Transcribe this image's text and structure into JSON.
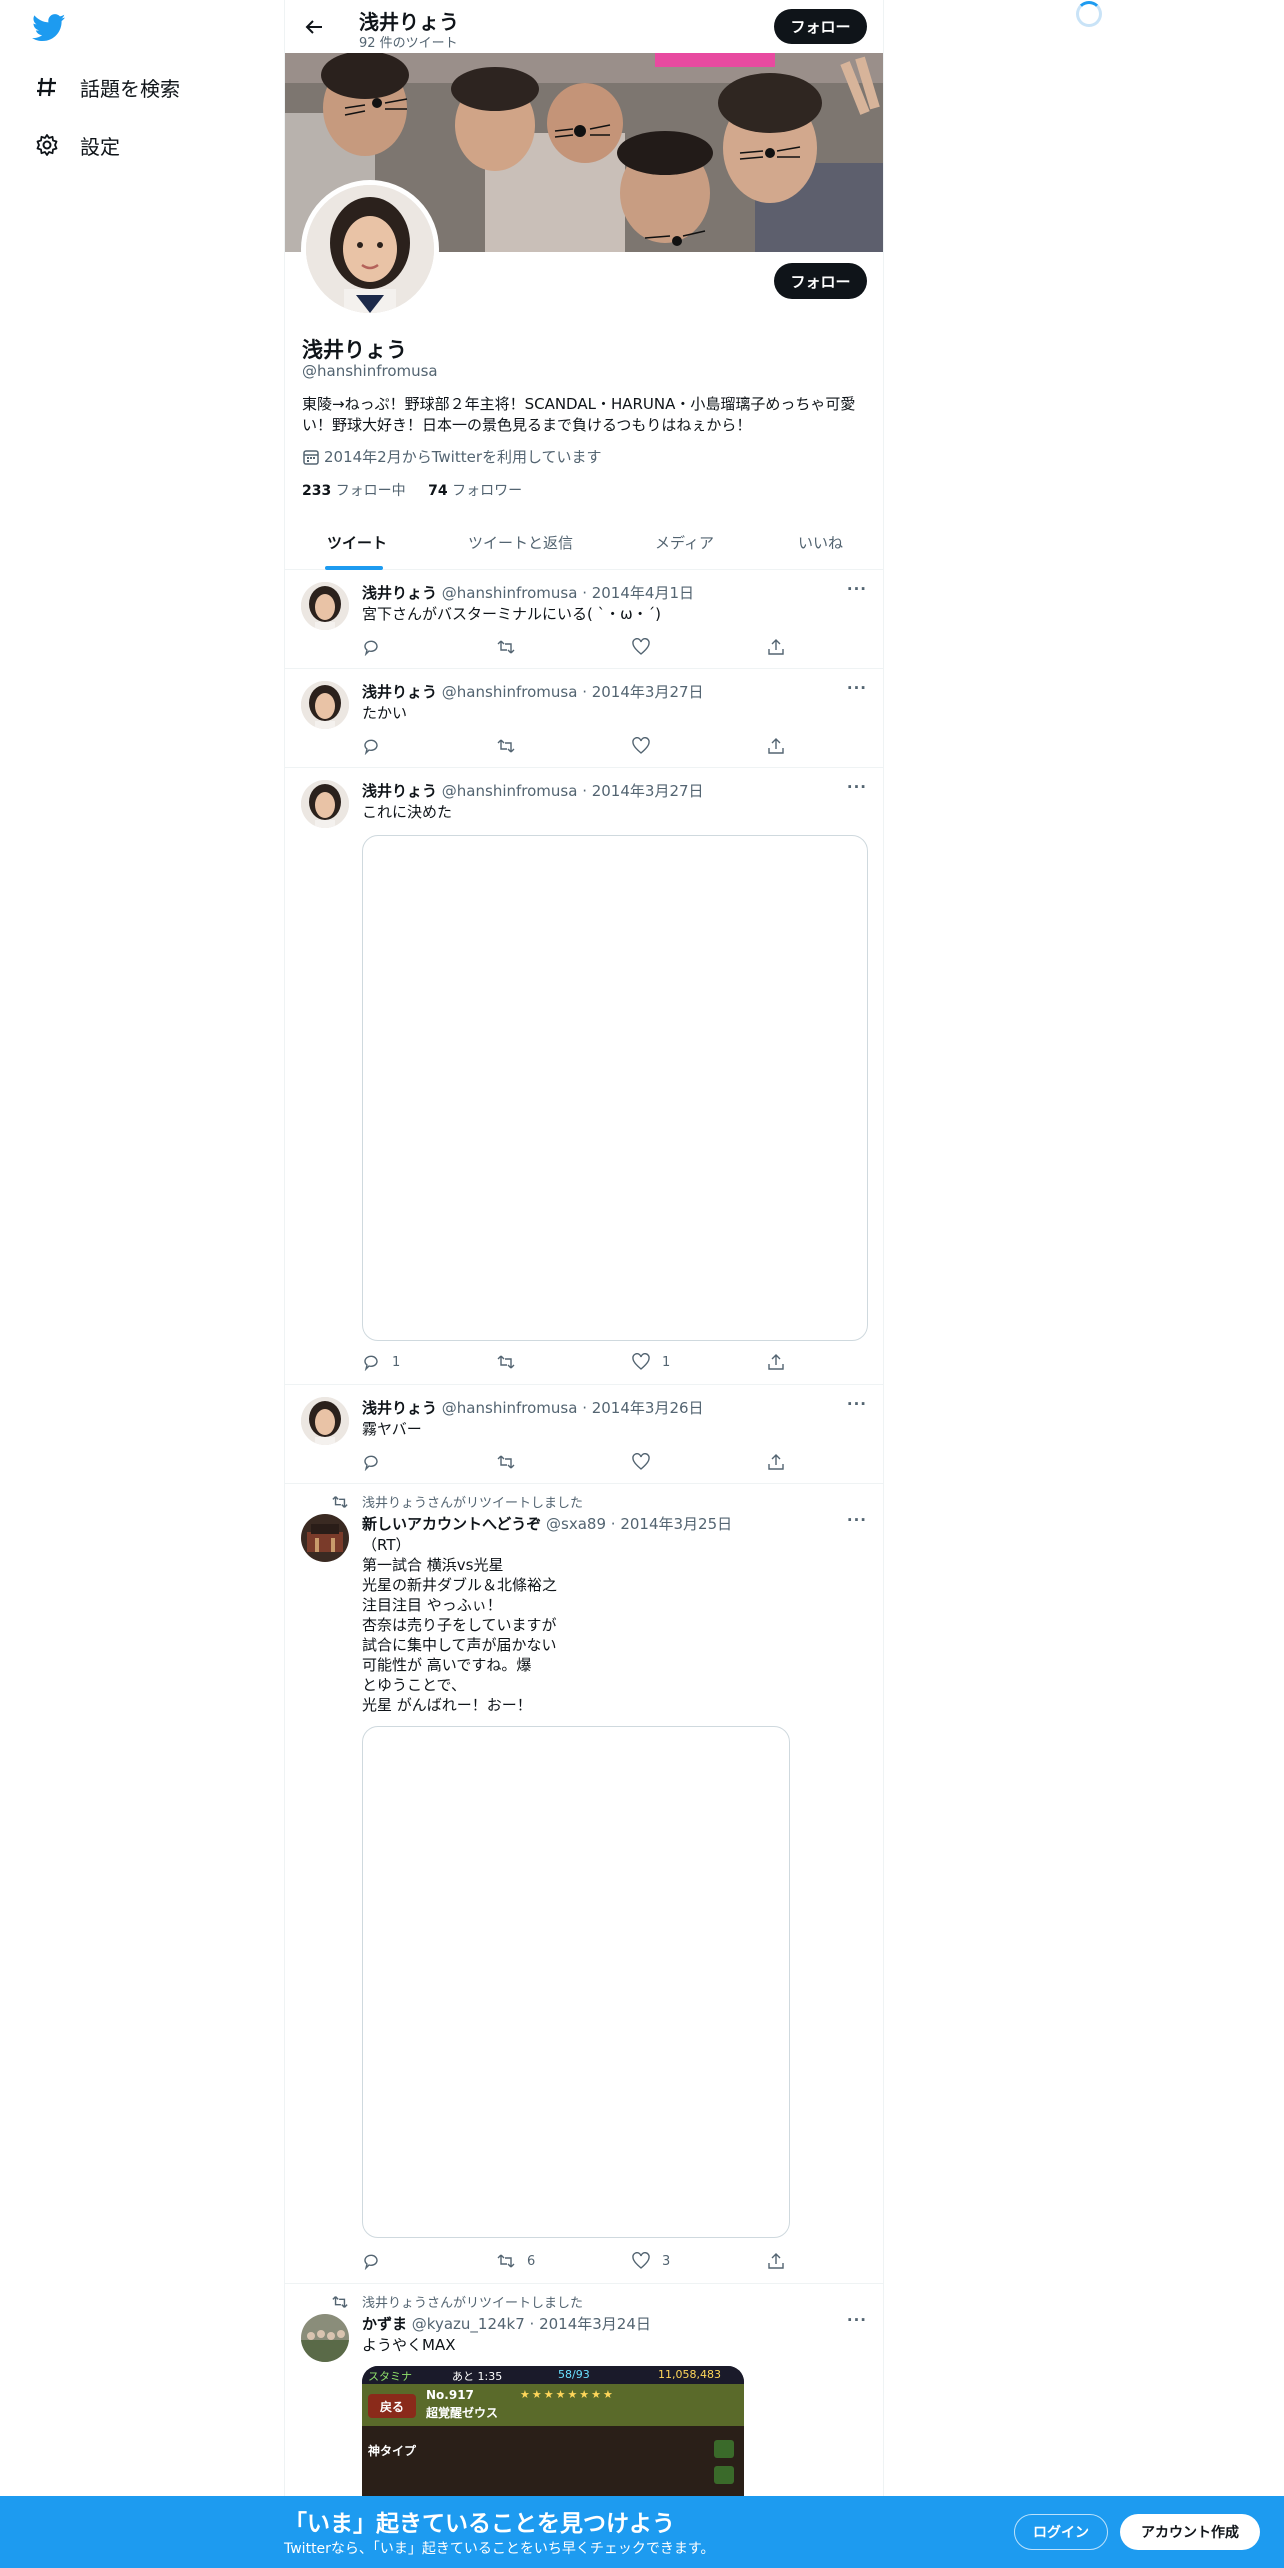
{
  "sidebar": {
    "items": [
      {
        "label": "話題を検索",
        "icon": "hashtag-icon"
      },
      {
        "label": "設定",
        "icon": "gear-icon"
      }
    ]
  },
  "header": {
    "name": "浅井りょう",
    "tweet_count": "92 件のツイート",
    "follow_label": "フォロー"
  },
  "profile": {
    "name": "浅井りょう",
    "handle": "@hanshinfromusa",
    "bio": "東陵→ねっぷ！野球部２年主将！SCANDAL・HARUNA・小島瑠璃子めっちゃ可愛い！野球大好き！日本一の景色見るまで負けるつもりはねぇから！",
    "joined": "2014年2月からTwitterを利用しています",
    "following_count": "233",
    "following_label": "フォロー中",
    "followers_count": "74",
    "followers_label": "フォロワー",
    "follow_label": "フォロー"
  },
  "tabs": [
    "ツイート",
    "ツイートと返信",
    "メディア",
    "いいね"
  ],
  "tweets": [
    {
      "name": "浅井りょう",
      "meta": "@hanshinfromusa · 2014年4月1日",
      "text": "宮下さんがバスターミナルにいる( ˋ・ω・ˊ)",
      "reply": "",
      "retweet": "",
      "like": ""
    },
    {
      "name": "浅井りょう",
      "meta": "@hanshinfromusa · 2014年3月27日",
      "text": "たかい",
      "reply": "",
      "retweet": "",
      "like": ""
    },
    {
      "name": "浅井りょう",
      "meta": "@hanshinfromusa · 2014年3月27日",
      "text": "これに決めた",
      "reply": "1",
      "retweet": "",
      "like": "1"
    },
    {
      "name": "浅井りょう",
      "meta": "@hanshinfromusa · 2014年3月26日",
      "text": "霧ヤバー",
      "reply": "",
      "retweet": "",
      "like": ""
    },
    {
      "retweeted_by": "浅井りょうさんがリツイートしました",
      "name": "新しいアカウントへどうぞ",
      "meta": "@sxa89 · 2014年3月25日",
      "text": "（RT）\n第一試合 横浜vs光星\n光星の新井ダブル＆北條裕之\n注目注目 やっふぃ！\n杏奈は売り子をしていますが\n試合に集中して声が届かない\n可能性が 高いですね。爆\nとゆうことで、\n光星 がんばれー！おー！",
      "reply": "",
      "retweet": "6",
      "like": "3"
    },
    {
      "retweeted_by": "浅井りょうさんがリツイートしました",
      "name": "かずま",
      "meta": "@kyazu_124k7 · 2014年3月24日",
      "text": "ようやくMAX",
      "reply": "",
      "retweet": "",
      "like": ""
    }
  ],
  "game_screenshot": {
    "stamina": "スタミナ",
    "timer": "あと 1:35",
    "stamina_value": "58/93",
    "coins": "11,058,483",
    "back": "戻る",
    "card_no": "No.917",
    "card_name": "超覚醒ゼウス",
    "card_type": "神タイプ"
  },
  "bottom_bar": {
    "title": "「いま」起きていることを見つけよう",
    "subtitle": "Twitterなら、「いま」起きていることをいち早くチェックできます。",
    "login": "ログイン",
    "signup": "アカウント作成"
  },
  "colors": {
    "accent": "#1d9bf0",
    "text": "#0f1419",
    "muted": "#536471"
  }
}
